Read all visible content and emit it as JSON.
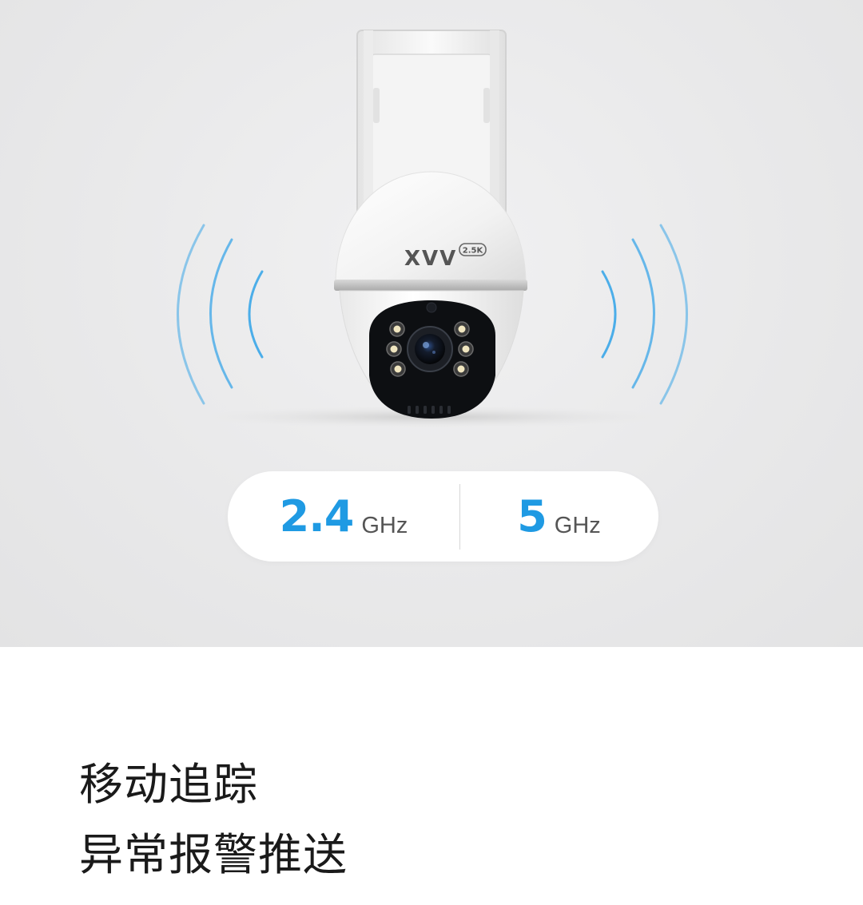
{
  "product": {
    "brand_logo": "XVV",
    "resolution_badge": "2.5K"
  },
  "bands": [
    {
      "value": "2.4",
      "unit": "GHz"
    },
    {
      "value": "5",
      "unit": "GHz"
    }
  ],
  "caption": {
    "line1": "移动追踪",
    "line2": "异常报警推送"
  },
  "colors": {
    "accent": "#1f9ae3",
    "wave": "#3aa6e8",
    "hero_background": "#e9e9ea",
    "text": "#1a1a1a"
  }
}
